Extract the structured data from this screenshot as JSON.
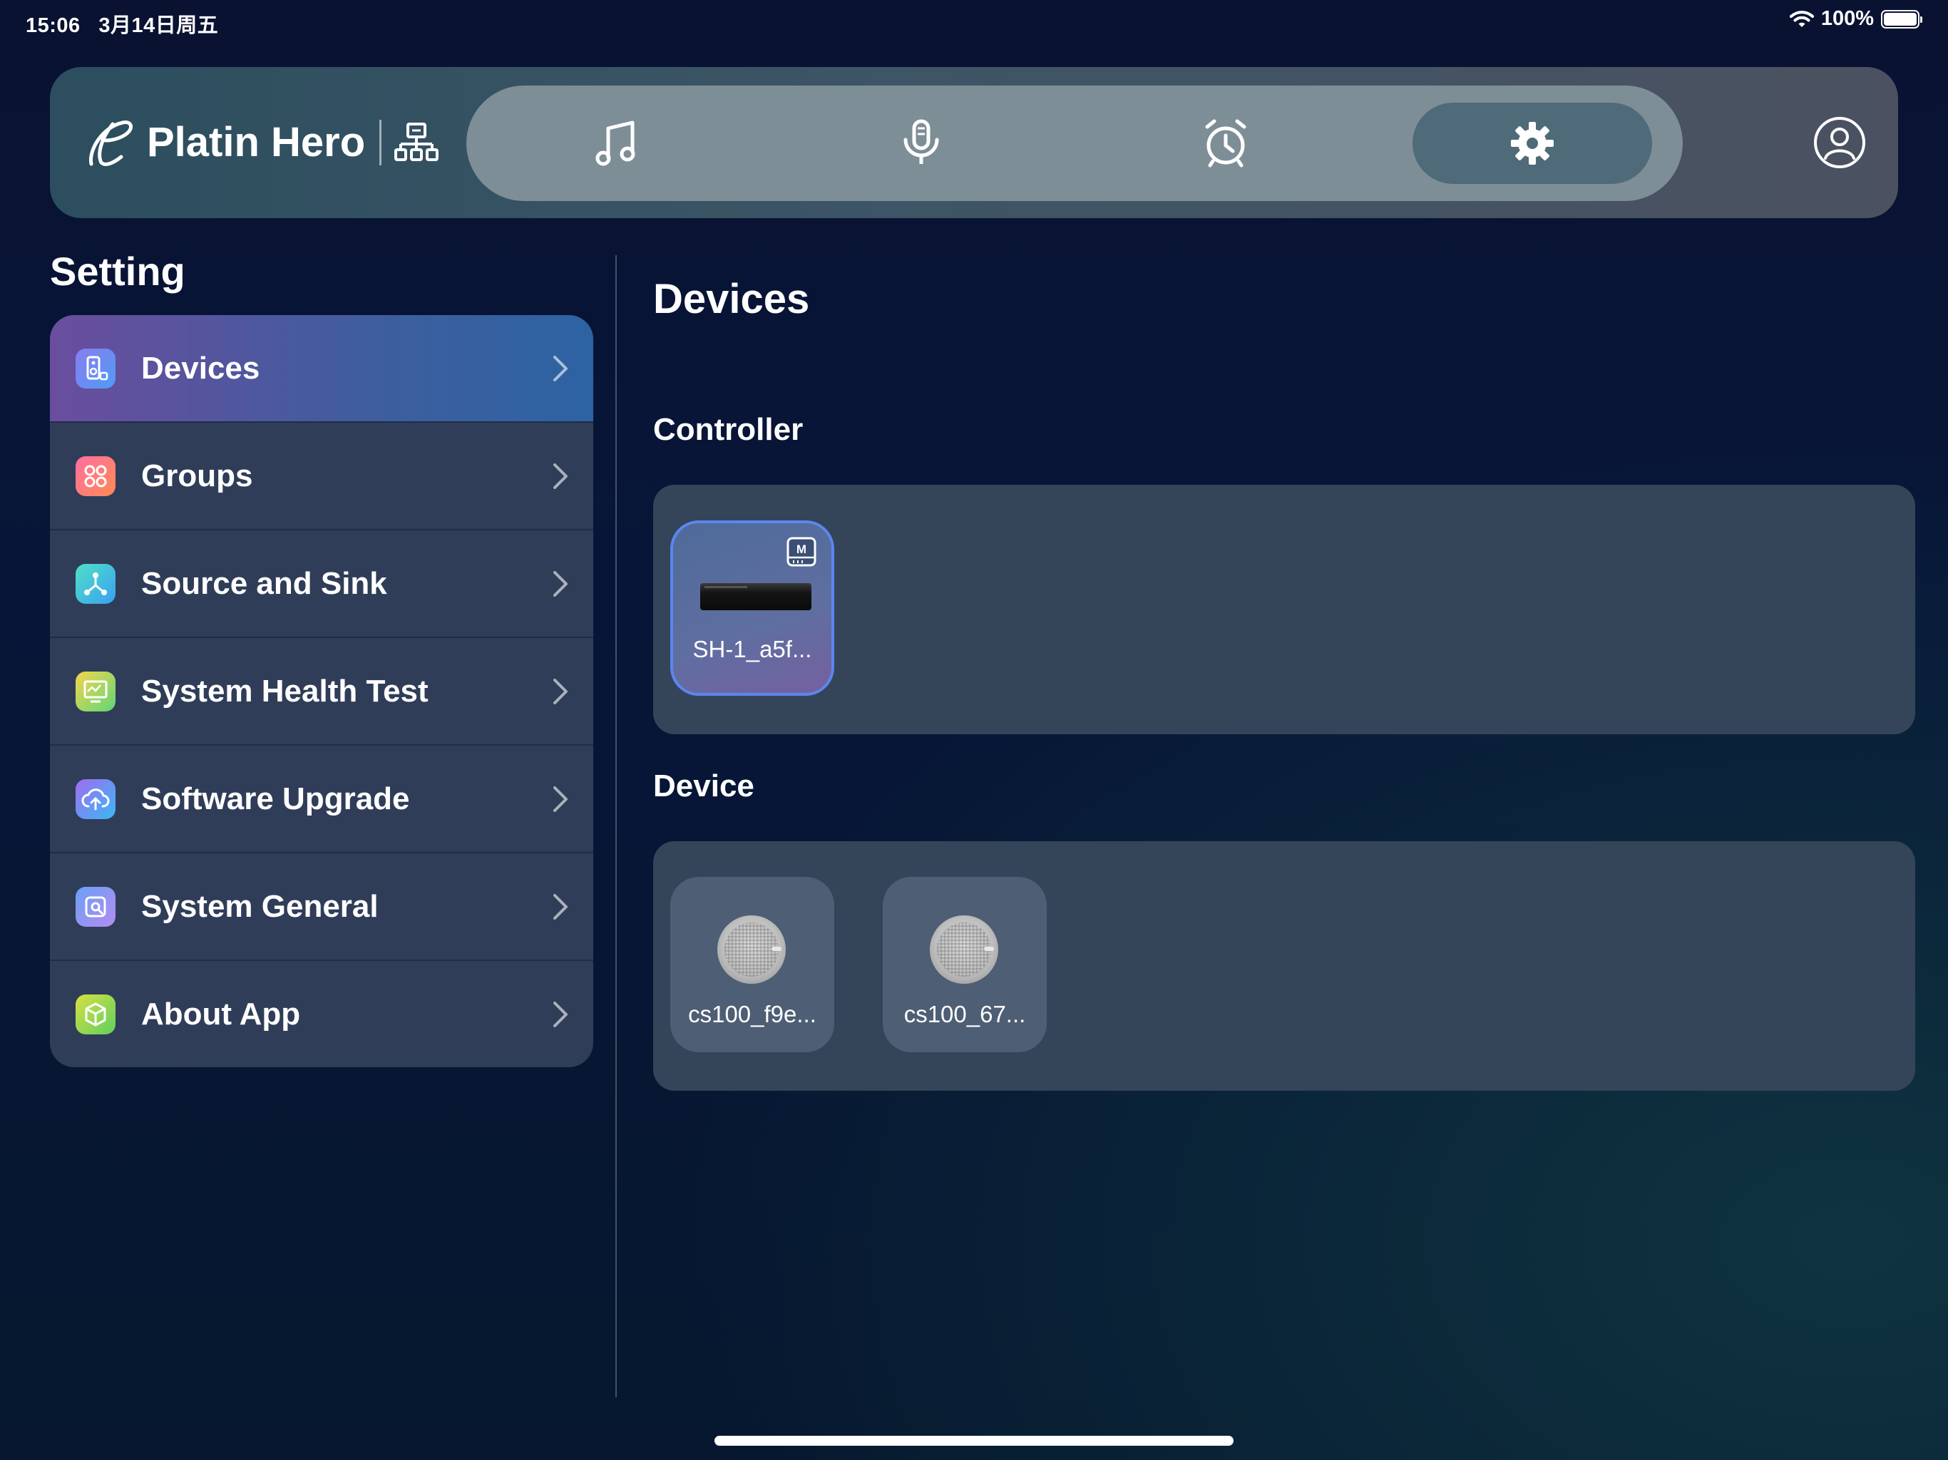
{
  "status_bar": {
    "time": "15:06",
    "date": "3月14日周五",
    "battery": "100%"
  },
  "header": {
    "app_title": "Platin Hero",
    "tabs": [
      {
        "name": "music",
        "icon": "music-note-icon",
        "active": false
      },
      {
        "name": "microphone",
        "icon": "microphone-icon",
        "active": false
      },
      {
        "name": "timer",
        "icon": "alarm-clock-icon",
        "active": false
      },
      {
        "name": "settings",
        "icon": "gear-icon",
        "active": true
      }
    ]
  },
  "sidebar": {
    "title": "Setting",
    "items": [
      {
        "label": "Devices",
        "icon": "speaker-device-icon",
        "active": true
      },
      {
        "label": "Groups",
        "icon": "groups-icon",
        "active": false
      },
      {
        "label": "Source and Sink",
        "icon": "source-sink-icon",
        "active": false
      },
      {
        "label": "System Health Test",
        "icon": "health-monitor-icon",
        "active": false
      },
      {
        "label": "Software Upgrade",
        "icon": "cloud-upload-icon",
        "active": false
      },
      {
        "label": "System General",
        "icon": "system-general-icon",
        "active": false
      },
      {
        "label": "About App",
        "icon": "app-cube-icon",
        "active": false
      }
    ]
  },
  "main": {
    "title": "Devices",
    "controller": {
      "section_title": "Controller",
      "devices": [
        {
          "name": "SH-1_a5f...",
          "badge": "M"
        }
      ]
    },
    "device": {
      "section_title": "Device",
      "devices": [
        {
          "name": "cs100_f9e..."
        },
        {
          "name": "cs100_67..."
        }
      ]
    }
  },
  "colors": {
    "accent_active_tab": "#4f6a78",
    "nav_pill": "#7e8e97",
    "menu_active_start": "#6a4d9e",
    "menu_active_end": "#2d63a3",
    "controller_border": "#5b86f0"
  }
}
